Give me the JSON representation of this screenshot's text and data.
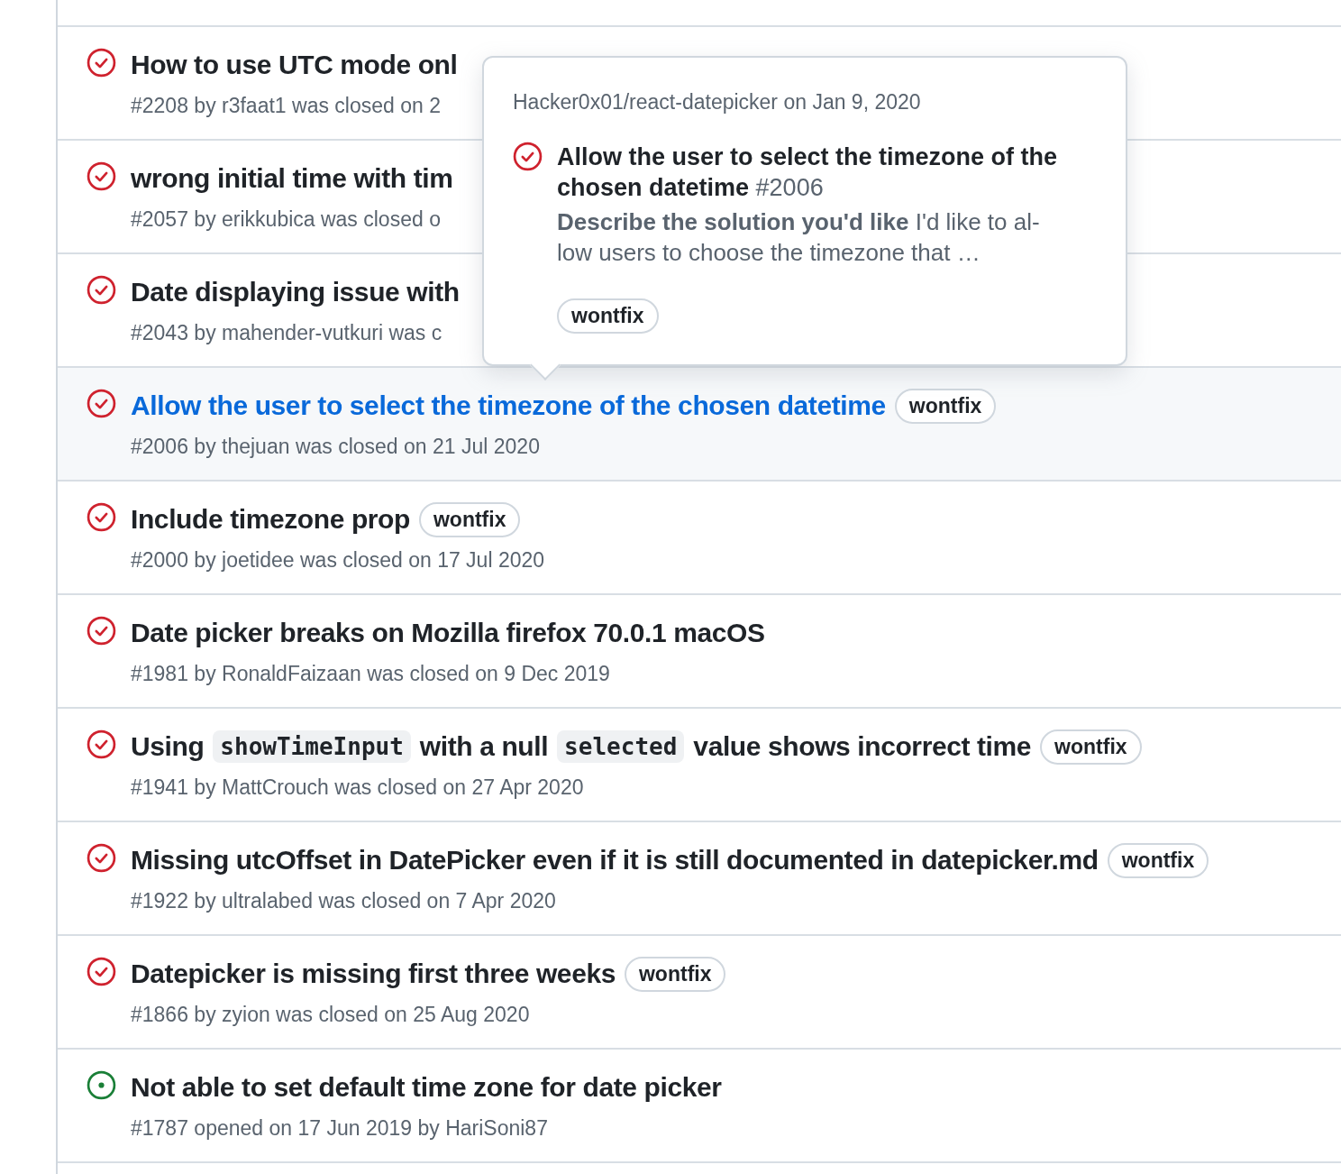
{
  "issues": [
    {
      "kind": "closed",
      "selected": false,
      "title": [
        {
          "kind": "text",
          "text": "How to use UTC mode onl"
        }
      ],
      "meta": "#2208 by r3faat1 was closed on 2"
    },
    {
      "kind": "closed",
      "selected": false,
      "title": [
        {
          "kind": "text",
          "text": "wrong initial time with tim"
        }
      ],
      "meta": "#2057 by erikkubica was closed o"
    },
    {
      "kind": "closed",
      "selected": false,
      "title": [
        {
          "kind": "text",
          "text": "Date displaying issue with"
        }
      ],
      "meta": "#2043 by mahender-vutkuri was c"
    },
    {
      "kind": "closed",
      "selected": true,
      "title": [
        {
          "kind": "text",
          "text": "Allow the user to select the timezone of the chosen datetime"
        }
      ],
      "meta": "#2006 by thejuan was closed on 21 Jul 2020",
      "labels": [
        "wontfix"
      ]
    },
    {
      "kind": "closed",
      "selected": false,
      "title": [
        {
          "kind": "text",
          "text": "Include timezone prop"
        }
      ],
      "meta": "#2000 by joetidee was closed on 17 Jul 2020",
      "labels": [
        "wontfix"
      ]
    },
    {
      "kind": "closed",
      "selected": false,
      "title": [
        {
          "kind": "text",
          "text": "Date picker breaks on Mozilla firefox 70.0.1 macOS"
        }
      ],
      "meta": "#1981 by RonaldFaizaan was closed on 9 Dec 2019"
    },
    {
      "kind": "closed",
      "selected": false,
      "title": [
        {
          "kind": "text",
          "text": "Using"
        },
        {
          "kind": "code",
          "text": "showTimeInput"
        },
        {
          "kind": "text",
          "text": "with a null"
        },
        {
          "kind": "code",
          "text": "selected"
        },
        {
          "kind": "text",
          "text": "value shows incorrect time"
        }
      ],
      "meta": "#1941 by MattCrouch was closed on 27 Apr 2020",
      "labels": [
        "wontfix"
      ]
    },
    {
      "kind": "closed",
      "selected": false,
      "title": [
        {
          "kind": "text",
          "text": "Missing utcOffset in DatePicker even if it is still documented in datepicker.md"
        }
      ],
      "meta": "#1922 by ultralabed was closed on 7 Apr 2020",
      "labels": [
        "wontfix"
      ]
    },
    {
      "kind": "closed",
      "selected": false,
      "title": [
        {
          "kind": "text",
          "text": "Datepicker is missing first three weeks"
        }
      ],
      "meta": "#1866 by zyion was closed on 25 Aug 2020",
      "labels": [
        "wontfix"
      ]
    },
    {
      "kind": "open",
      "selected": false,
      "title": [
        {
          "kind": "text",
          "text": "Not able to set default time zone for date picker"
        }
      ],
      "meta": "#1787 opened on 17 Jun 2019 by HariSoni87"
    }
  ],
  "popup": {
    "context": "Hacker0x01/react-datepicker on Jan 9, 2020",
    "kind": "closed",
    "title": "Allow the user to select the timezone of the chosen datetime",
    "number": "#2006",
    "body": "**Describe the solution you'd like** I'd like to al-low users to choose the timezone that …",
    "labels": [
      "wontfix"
    ]
  }
}
